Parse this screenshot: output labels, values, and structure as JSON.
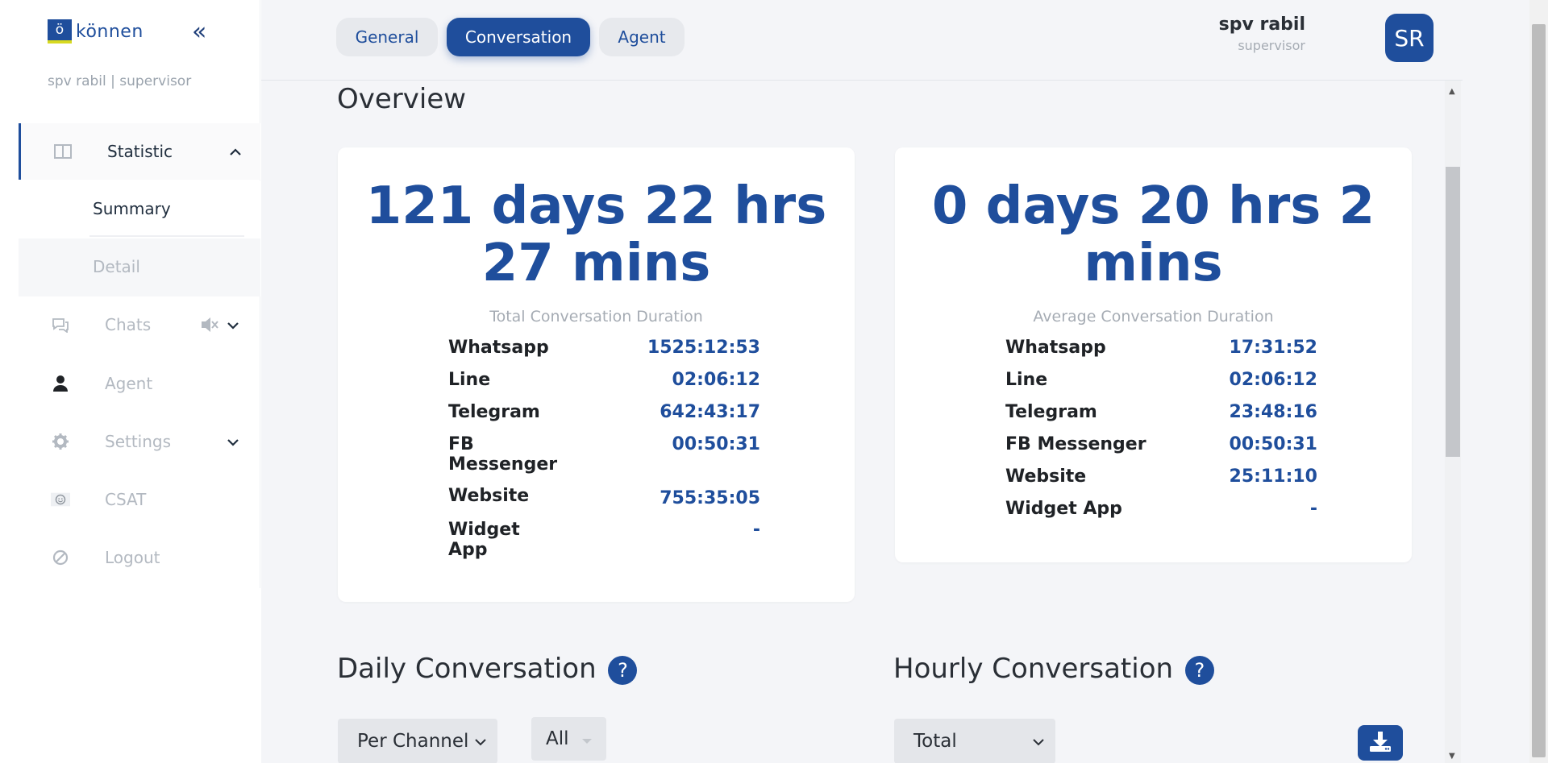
{
  "brand": {
    "logo_letter": "ö",
    "logo_text": "können"
  },
  "sidebar": {
    "collapse_icon": "«",
    "user_line": "spv rabil | supervisor",
    "items": [
      {
        "label": "Statistic",
        "icon": "columns-icon"
      },
      {
        "label": "Chats",
        "icon": "chat-icon"
      },
      {
        "label": "Agent",
        "icon": "user-icon"
      },
      {
        "label": "Settings",
        "icon": "gear-icon"
      },
      {
        "label": "CSAT",
        "icon": "smiley-icon"
      },
      {
        "label": "Logout",
        "icon": "ban-icon"
      }
    ],
    "sub_items": [
      {
        "label": "Summary"
      },
      {
        "label": "Detail"
      }
    ]
  },
  "header": {
    "tabs": [
      {
        "label": "General"
      },
      {
        "label": "Conversation"
      },
      {
        "label": "Agent"
      }
    ],
    "active_tab": "Conversation",
    "user_name": "spv rabil",
    "user_role": "supervisor",
    "avatar_initials": "SR"
  },
  "overview": {
    "title": "Overview",
    "total": {
      "line1": "121 days 22 hrs",
      "line2": "27 mins",
      "caption": "Total Conversation Duration",
      "rows": [
        {
          "channel": "Whatsapp",
          "value": "1525:12:53"
        },
        {
          "channel": "Line",
          "value": "02:06:12"
        },
        {
          "channel": "Telegram",
          "value": "642:43:17"
        },
        {
          "channel": "FB Messenger",
          "value": "00:50:31"
        },
        {
          "channel": "Website",
          "value": "755:35:05"
        },
        {
          "channel": "Widget App",
          "value": "-"
        }
      ]
    },
    "average": {
      "line1": "0 days 20 hrs 2",
      "line2": "mins",
      "caption": "Average Conversation Duration",
      "rows": [
        {
          "channel": "Whatsapp",
          "value": "17:31:52"
        },
        {
          "channel": "Line",
          "value": "02:06:12"
        },
        {
          "channel": "Telegram",
          "value": "23:48:16"
        },
        {
          "channel": "FB Messenger",
          "value": "00:50:31"
        },
        {
          "channel": "Website",
          "value": "25:11:10"
        },
        {
          "channel": "Widget App",
          "value": "-"
        }
      ]
    }
  },
  "daily": {
    "title": "Daily Conversation",
    "help": "?",
    "select1": "Per Channel",
    "select2": "All"
  },
  "hourly": {
    "title": "Hourly Conversation",
    "help": "?",
    "select1": "Total"
  },
  "colors": {
    "accent": "#1f4e9c",
    "background": "#f4f5f8"
  }
}
